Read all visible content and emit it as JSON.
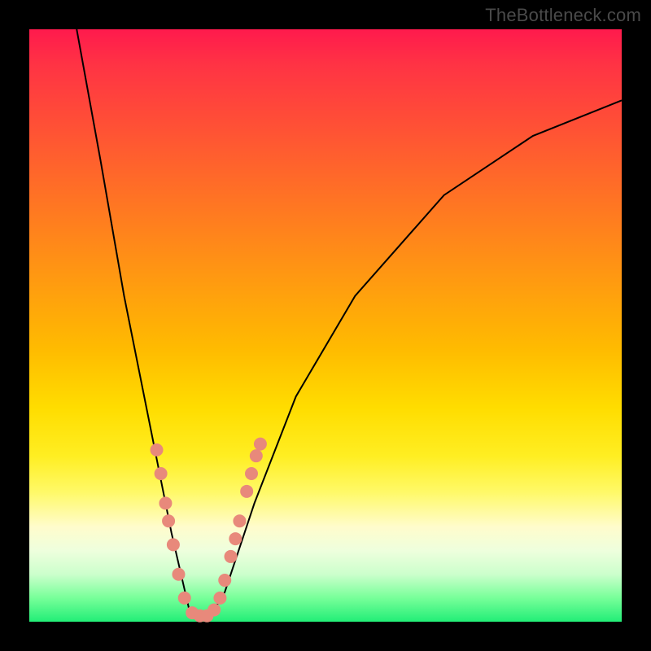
{
  "watermark": "TheBottleneck.com",
  "chart_data": {
    "type": "line",
    "title": "",
    "xlabel": "",
    "ylabel": "",
    "ylim": [
      0,
      100
    ],
    "xlim": [
      0,
      100
    ],
    "note": "Bottleneck V-curve: two black decay curves meeting near x≈27 at the green zone (y≈0). Pink dots mark sample points along both branches near the valley.",
    "series": [
      {
        "name": "left-curve",
        "points": [
          {
            "x": 8,
            "y": 100
          },
          {
            "x": 12,
            "y": 78
          },
          {
            "x": 16,
            "y": 55
          },
          {
            "x": 20,
            "y": 35
          },
          {
            "x": 24,
            "y": 15
          },
          {
            "x": 27,
            "y": 2
          },
          {
            "x": 30,
            "y": 0
          }
        ]
      },
      {
        "name": "right-curve",
        "points": [
          {
            "x": 30,
            "y": 0
          },
          {
            "x": 33,
            "y": 5
          },
          {
            "x": 38,
            "y": 20
          },
          {
            "x": 45,
            "y": 38
          },
          {
            "x": 55,
            "y": 55
          },
          {
            "x": 70,
            "y": 72
          },
          {
            "x": 85,
            "y": 82
          },
          {
            "x": 100,
            "y": 88
          }
        ]
      }
    ],
    "dots": [
      {
        "x": 21.5,
        "y": 29
      },
      {
        "x": 22.2,
        "y": 25
      },
      {
        "x": 23.0,
        "y": 20
      },
      {
        "x": 23.5,
        "y": 17
      },
      {
        "x": 24.3,
        "y": 13
      },
      {
        "x": 25.2,
        "y": 8
      },
      {
        "x": 26.2,
        "y": 4
      },
      {
        "x": 27.5,
        "y": 1.5
      },
      {
        "x": 28.8,
        "y": 1
      },
      {
        "x": 30.0,
        "y": 1
      },
      {
        "x": 31.2,
        "y": 2
      },
      {
        "x": 32.2,
        "y": 4
      },
      {
        "x": 33.0,
        "y": 7
      },
      {
        "x": 34.0,
        "y": 11
      },
      {
        "x": 34.8,
        "y": 14
      },
      {
        "x": 35.5,
        "y": 17
      },
      {
        "x": 36.7,
        "y": 22
      },
      {
        "x": 37.5,
        "y": 25
      },
      {
        "x": 38.3,
        "y": 28
      },
      {
        "x": 39.0,
        "y": 30
      }
    ]
  }
}
